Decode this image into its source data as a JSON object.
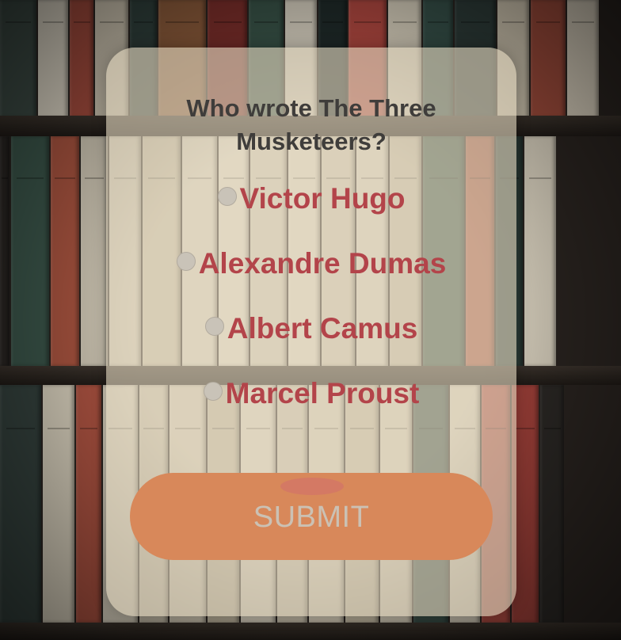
{
  "quiz": {
    "question": "Who wrote The Three Musketeers?",
    "options": [
      {
        "label": "Victor Hugo"
      },
      {
        "label": "Alexandre Dumas"
      },
      {
        "label": "Albert Camus"
      },
      {
        "label": "Marcel Proust"
      }
    ],
    "submit_label": "SUBMIT"
  },
  "colors": {
    "option_text": "#b3444a",
    "question_text": "#3f3d3b",
    "submit_button": "#d8885a",
    "card_background": "#e2d6be"
  }
}
